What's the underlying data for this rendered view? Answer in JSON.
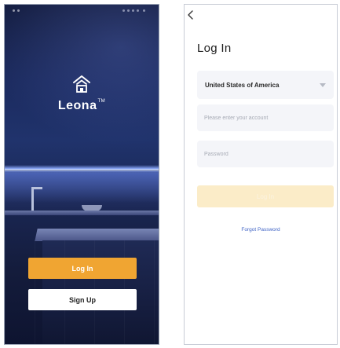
{
  "splash": {
    "brand": "Leona",
    "trademark": "TM",
    "login_label": "Log In",
    "signup_label": "Sign Up",
    "accent_color": "#f0a532",
    "logo_icon": "smart-home-icon"
  },
  "login": {
    "back_icon": "chevron-left-icon",
    "title": "Log In",
    "country": "United States of America",
    "account_placeholder": "Please enter your account",
    "password_placeholder": "Password",
    "submit_label": "Log In",
    "forgot_label": "Forgot Password",
    "link_color": "#3f63c5",
    "submit_color": "#fbecc8"
  }
}
